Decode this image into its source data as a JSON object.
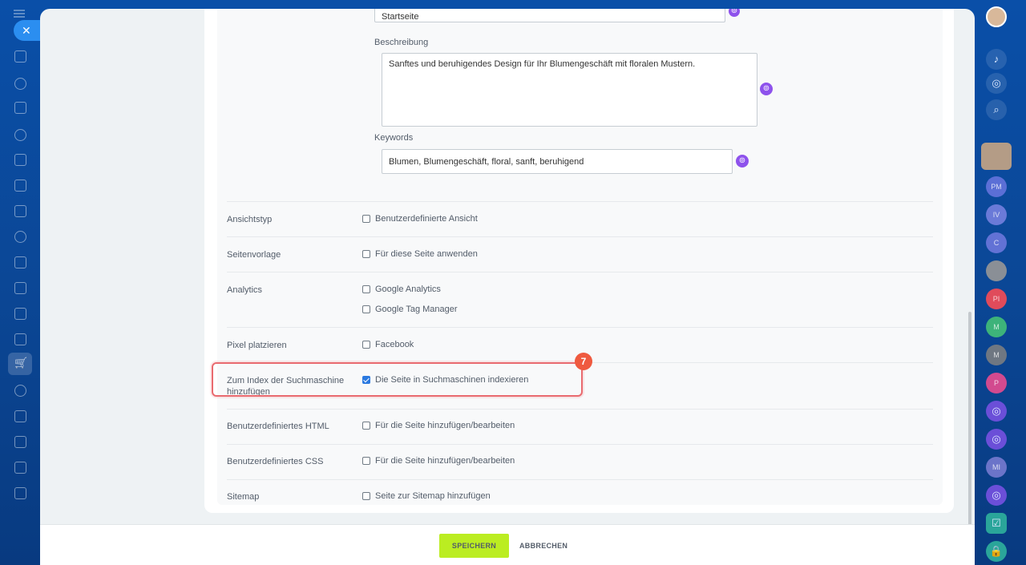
{
  "seo": {
    "title_value": "Startseite",
    "description_label": "Beschreibung",
    "description_value": "Sanftes und beruhigendes Design für Ihr Blumengeschäft mit floralen Mustern.",
    "keywords_label": "Keywords",
    "keywords_value": "Blumen, Blumengeschäft, floral, sanft, beruhigend"
  },
  "settings": [
    {
      "label": "Ansichtstyp",
      "options": [
        {
          "text": "Benutzerdefinierte Ansicht",
          "checked": false
        }
      ]
    },
    {
      "label": "Seitenvorlage",
      "options": [
        {
          "text": "Für diese Seite anwenden",
          "checked": false
        }
      ]
    },
    {
      "label": "Analytics",
      "options": [
        {
          "text": "Google Analytics",
          "checked": false
        },
        {
          "text": "Google Tag Manager",
          "checked": false
        }
      ]
    },
    {
      "label": "Pixel platzieren",
      "options": [
        {
          "text": "Facebook",
          "checked": false
        }
      ]
    },
    {
      "label": "Zum Index der Suchmaschine hinzufügen",
      "options": [
        {
          "text": "Die Seite in Suchmaschinen indexieren",
          "checked": true
        }
      ]
    },
    {
      "label": "Benutzerdefiniertes HTML",
      "options": [
        {
          "text": "Für die Seite hinzufügen/bearbeiten",
          "checked": false
        }
      ]
    },
    {
      "label": "Benutzerdefiniertes CSS",
      "options": [
        {
          "text": "Für die Seite hinzufügen/bearbeiten",
          "checked": false
        }
      ]
    },
    {
      "label": "Sitemap",
      "options": [
        {
          "text": "Seite zur Sitemap hinzufügen",
          "checked": false
        }
      ]
    }
  ],
  "annotation": {
    "step_number": "7"
  },
  "footer": {
    "save_label": "SPEICHERN",
    "cancel_label": "ABBRECHEN"
  },
  "right_sidebar": {
    "avatars": [
      "PM",
      "IV",
      "C",
      "PI",
      "M",
      "M",
      "P",
      "MI"
    ],
    "colors": {
      "pm": "#5b6fd6",
      "iv": "#6a7ad8",
      "c": "#6272d5",
      "pi": "#e04b5b",
      "m1": "#3db37a",
      "m2": "#6f7782",
      "p": "#d24a8f",
      "mi": "#6b74c9"
    }
  },
  "colors": {
    "accent_green": "#bbed21",
    "ai_purple": "#8e52ec",
    "highlight_red": "#e96a6f",
    "badge_orange": "#ef5a3f",
    "checkbox_blue": "#2b79e0"
  }
}
